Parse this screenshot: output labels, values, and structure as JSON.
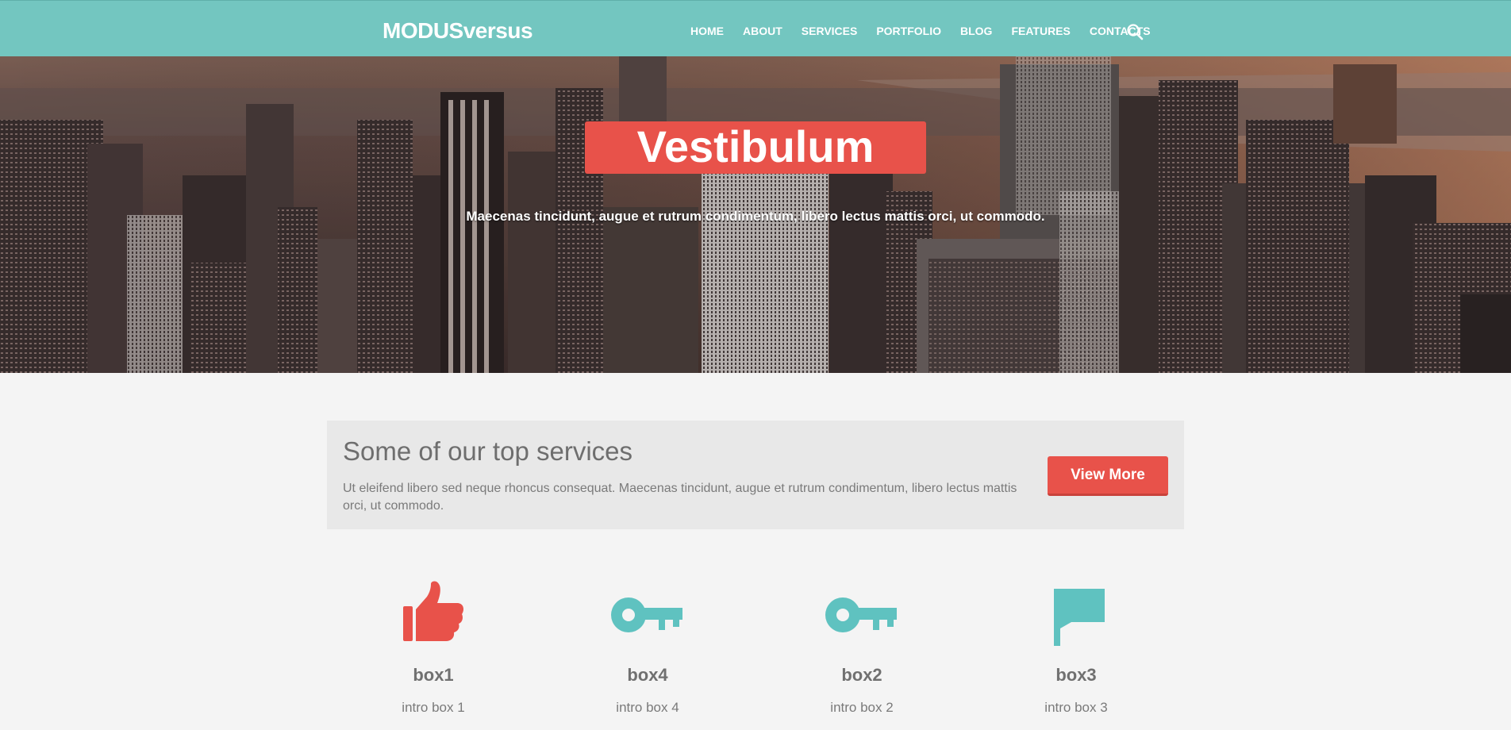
{
  "header": {
    "logo": "MODUSversus",
    "nav": [
      "HOME",
      "ABOUT",
      "SERVICES",
      "PORTFOLIO",
      "BLOG",
      "FEATURES",
      "CONTACTS"
    ],
    "search_icon": "search-icon"
  },
  "hero": {
    "title": "Vestibulum",
    "subtitle": "Maecenas tincidunt, augue et rutrum condimentum, libero lectus mattis orci, ut commodo."
  },
  "services": {
    "title": "Some of our top services",
    "text": "Ut eleifend libero sed neque rhoncus consequat. Maecenas tincidunt, augue et rutrum condimentum, libero lectus mattis orci, ut commodo.",
    "button": "View More"
  },
  "boxes": [
    {
      "icon": "thumbs-up-icon",
      "title": "box1",
      "intro": "intro box 1",
      "color": "#e8524a"
    },
    {
      "icon": "key-icon",
      "title": "box4",
      "intro": "intro box 4",
      "color": "#5fc2c0"
    },
    {
      "icon": "key-icon",
      "title": "box2",
      "intro": "intro box 2",
      "color": "#5fc2c0"
    },
    {
      "icon": "flag-icon",
      "title": "box3",
      "intro": "intro box 3",
      "color": "#5fc2c0"
    }
  ],
  "colors": {
    "header": "#73c6c0",
    "accent_red": "#e8524a",
    "accent_teal": "#5fc2c0",
    "background": "#f4f4f4"
  }
}
